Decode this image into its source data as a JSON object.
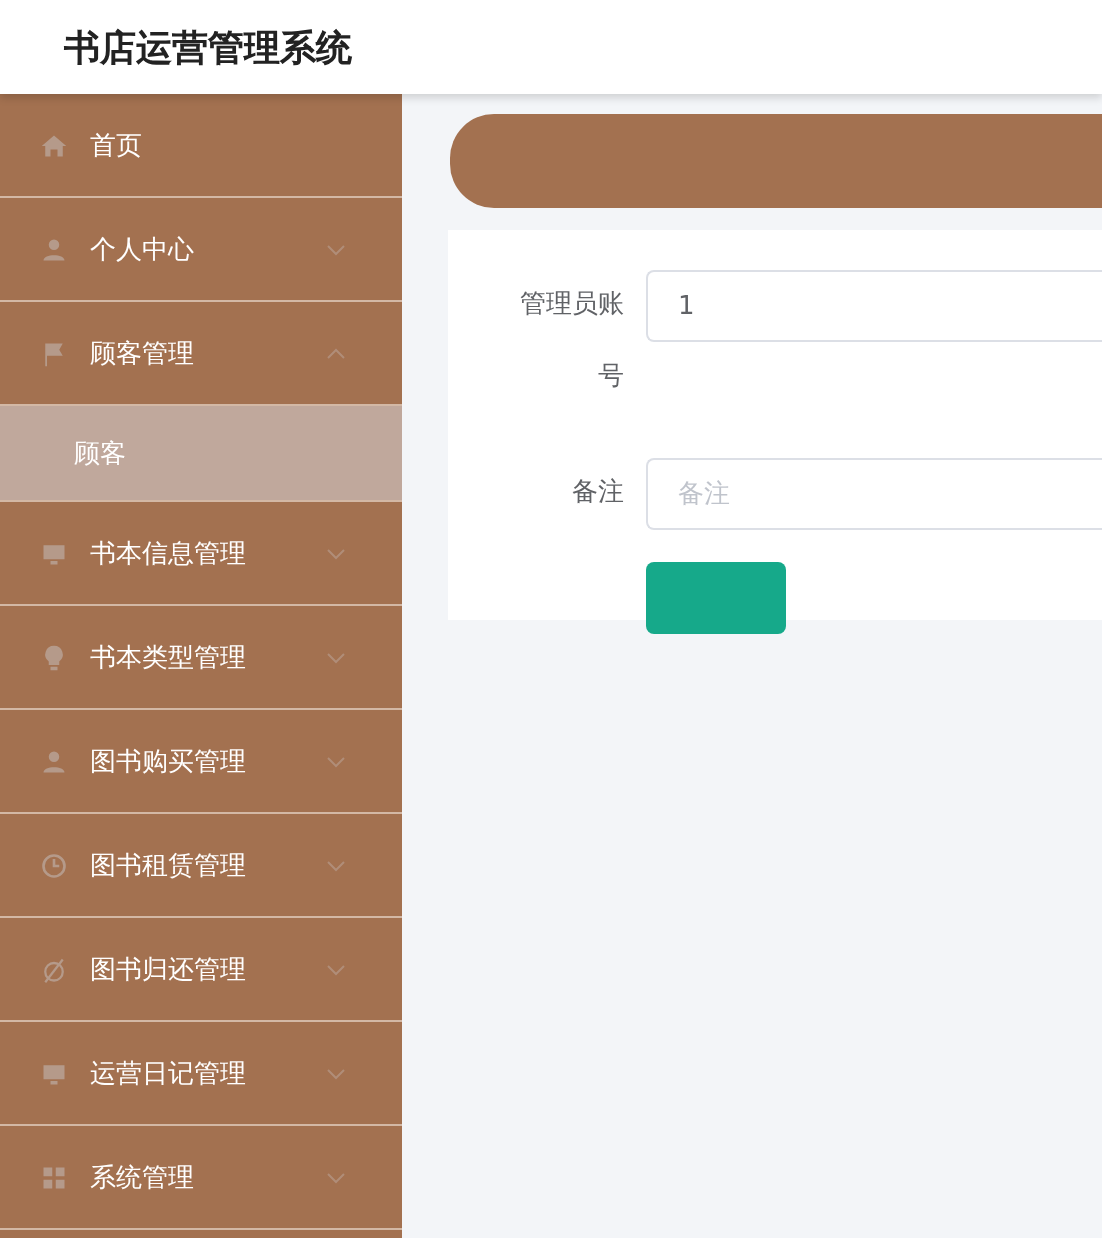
{
  "header": {
    "title": "书店运营管理系统"
  },
  "sidebar": {
    "items": [
      {
        "label": "首页"
      },
      {
        "label": "个人中心",
        "expanded": false
      },
      {
        "label": "顾客管理",
        "expanded": true,
        "children": [
          {
            "label": "顾客",
            "selected": true
          }
        ]
      },
      {
        "label": "书本信息管理",
        "expanded": false
      },
      {
        "label": "书本类型管理",
        "expanded": false
      },
      {
        "label": "图书购买管理",
        "expanded": false
      },
      {
        "label": "图书租赁管理",
        "expanded": false
      },
      {
        "label": "图书归还管理",
        "expanded": false
      },
      {
        "label": "运营日记管理",
        "expanded": false
      },
      {
        "label": "系统管理",
        "expanded": false
      }
    ]
  },
  "form": {
    "fields": [
      {
        "label": "管理员账号",
        "value": "1"
      },
      {
        "label": "备注",
        "placeholder": "备注"
      }
    ]
  }
}
